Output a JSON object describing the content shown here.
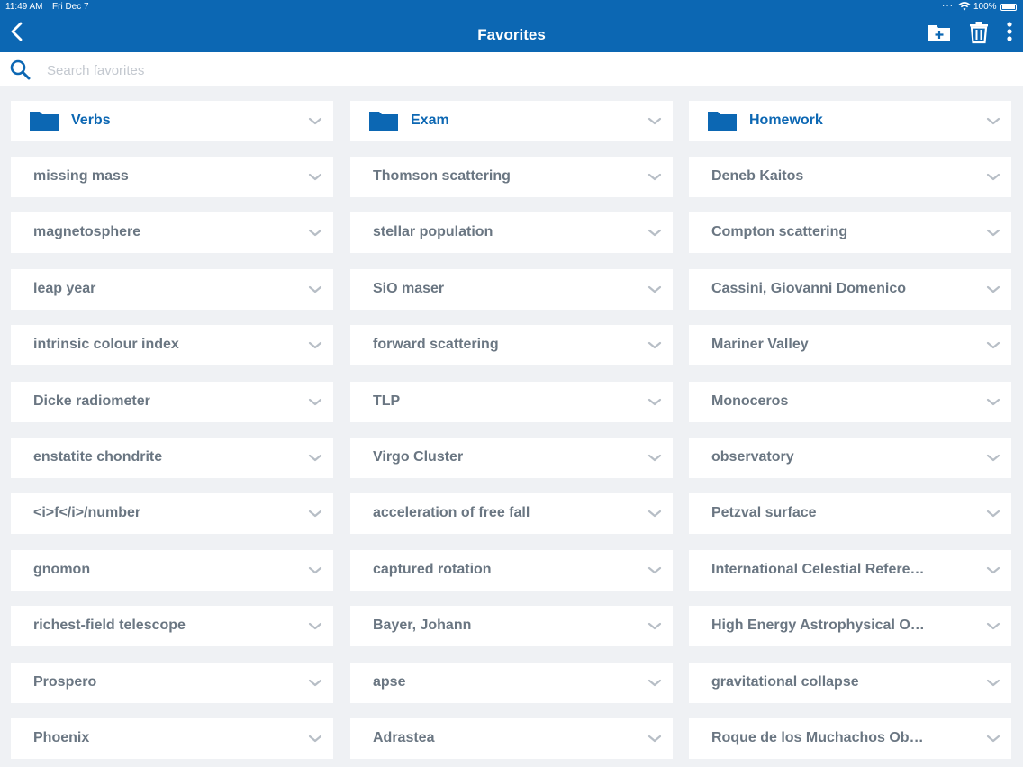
{
  "status_bar": {
    "time": "11:49 AM",
    "date": "Fri Dec 7",
    "battery": "100%"
  },
  "header": {
    "title": "Favorites"
  },
  "search": {
    "placeholder": "Search favorites"
  },
  "columns": [
    {
      "folder": "Verbs",
      "items": [
        "missing mass",
        "magnetosphere",
        "leap year",
        "intrinsic colour index",
        "Dicke radiometer",
        "enstatite chondrite",
        "<i>f</i>/number",
        "gnomon",
        "richest-field telescope",
        "Prospero",
        "Phoenix"
      ]
    },
    {
      "folder": "Exam",
      "items": [
        "Thomson scattering",
        "stellar population",
        "SiO maser",
        "forward scattering",
        "TLP",
        "Virgo Cluster",
        "acceleration of free fall",
        "captured rotation",
        "Bayer, Johann",
        "apse",
        "Adrastea"
      ]
    },
    {
      "folder": "Homework",
      "items": [
        "Deneb Kaitos",
        "Compton scattering",
        "Cassini, Giovanni Domenico",
        "Mariner Valley",
        "Monoceros",
        "observatory",
        "Petzval surface",
        "International Celestial Refere…",
        "High Energy Astrophysical O…",
        "gravitational collapse",
        "Roque de los Muchachos Ob…"
      ]
    }
  ],
  "colors": {
    "accent": "#0c67b3",
    "background": "#eff1f4",
    "item_text": "#6a7682",
    "chevron": "#b7bec6"
  },
  "icons": {
    "back": "chevron-left-icon",
    "new_folder": "folder-plus-icon",
    "delete": "trash-icon",
    "more": "more-vertical-icon",
    "search": "search-icon",
    "folder": "folder-icon",
    "expand": "chevron-down-icon"
  }
}
